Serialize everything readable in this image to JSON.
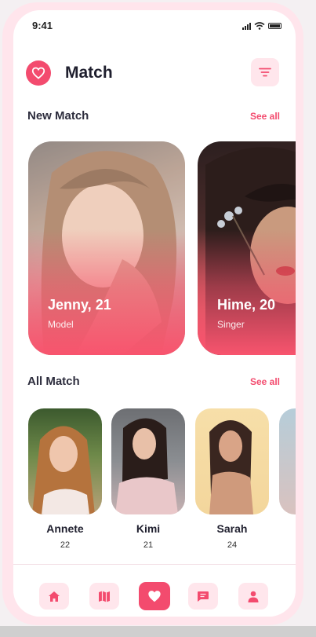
{
  "status_bar": {
    "time": "9:41"
  },
  "header": {
    "title": "Match",
    "logo_icon": "heart-logo-icon",
    "filter_icon": "filter-icon"
  },
  "new_match": {
    "title": "New Match",
    "see_all": "See all",
    "cards": [
      {
        "name_age": "Jenny, 21",
        "role": "Model"
      },
      {
        "name_age": "Hime, 20",
        "role": "Singer"
      }
    ]
  },
  "all_match": {
    "title": "All Match",
    "see_all": "See all",
    "people": [
      {
        "name": "Annete",
        "age": "22"
      },
      {
        "name": "Kimi",
        "age": "21"
      },
      {
        "name": "Sarah",
        "age": "24"
      }
    ]
  },
  "bottom_nav": {
    "items": [
      {
        "icon": "home-icon"
      },
      {
        "icon": "map-icon"
      },
      {
        "icon": "heart-icon",
        "active": true
      },
      {
        "icon": "chat-icon"
      },
      {
        "icon": "profile-icon"
      }
    ]
  },
  "colors": {
    "accent": "#f34b6e",
    "accent_soft": "#ffe6ec",
    "phone_frame": "#ffe5ec"
  }
}
